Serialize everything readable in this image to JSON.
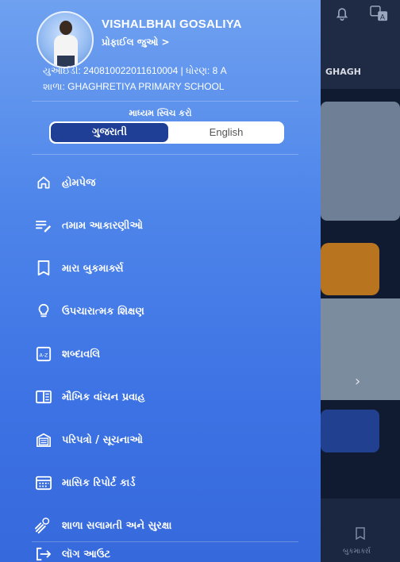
{
  "background": {
    "school_short": "GHAGH",
    "bottom_tab_label": "બુકમાર્ક્સ"
  },
  "profile": {
    "name": "VISHALBHAI GOSALIYA",
    "view_profile": "પ્રોફાઈલ જુઓ",
    "view_profile_arrow": ">",
    "uid_line": "યુઆઈડી: 240810022011610004 | ધોરણ: 8 A",
    "school_line": "શાળા: GHAGHRETIYA PRIMARY SCHOOL"
  },
  "language": {
    "title": "માધ્યમ સ્વિચ કરો",
    "options": [
      "ગુજરાતી",
      "English"
    ],
    "selected": "ગુજરાતી"
  },
  "menu": {
    "items": [
      {
        "label": "હોમપેજ",
        "icon": "home-icon"
      },
      {
        "label": "તમામ આકારણીઓ",
        "icon": "edit-list-icon"
      },
      {
        "label": "મારા બુકમાર્ક્સ",
        "icon": "bookmark-icon"
      },
      {
        "label": "ઉપચારાત્મક શિક્ષણ",
        "icon": "bulb-icon"
      },
      {
        "label": "શબ્દાવલિ",
        "icon": "glossary-icon"
      },
      {
        "label": "મૌખિક વાંચન પ્રવાહ",
        "icon": "book-open-icon"
      },
      {
        "label": "પરિપત્રો / સૂચનાઓ",
        "icon": "circulars-icon"
      },
      {
        "label": "માસિક રિપોર્ટ કાર્ડ",
        "icon": "calendar-icon"
      },
      {
        "label": "શાળા સલામતી અને સુરક્ષા",
        "icon": "safety-icon"
      },
      {
        "label": "લૉગ આઉટ",
        "icon": "logout-icon"
      }
    ]
  },
  "colors": {
    "drawer_top": "#6fa1f0",
    "drawer_bottom": "#3669dc",
    "toggle_active": "#1f3f97"
  }
}
